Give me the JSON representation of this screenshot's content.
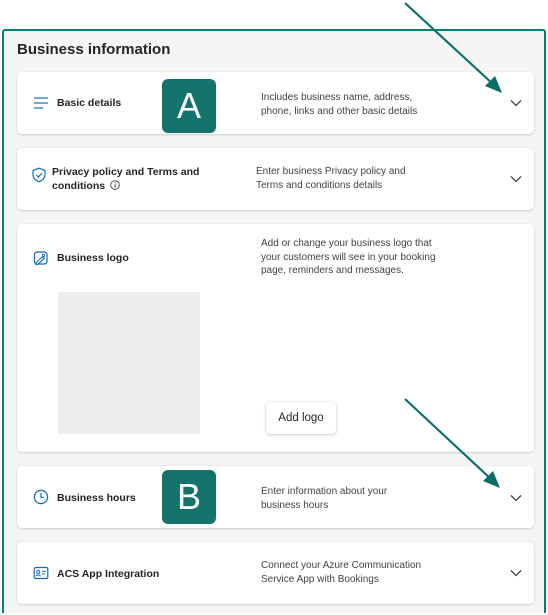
{
  "page": {
    "title": "Business information"
  },
  "sections": {
    "basic": {
      "title": "Basic details",
      "description": "Includes business name, address, phone, links and other basic details"
    },
    "privacy": {
      "title_line1": "Privacy policy and Terms and",
      "title_line2": "conditions",
      "description": "Enter business Privacy policy and Terms and conditions details"
    },
    "logo": {
      "title": "Business logo",
      "description": "Add or change your business logo that your customers will see in your booking page, reminders and messages.",
      "button_label": "Add logo"
    },
    "hours": {
      "title": "Business hours",
      "description": "Enter information about your business hours"
    },
    "acs": {
      "title": "ACS App Integration",
      "description": "Connect your Azure Communication Service App with Bookings"
    }
  },
  "annotations": {
    "badge_a": "A",
    "badge_b": "B"
  },
  "colors": {
    "accent_teal": "#00827a",
    "badge_bg": "#14736c",
    "icon_blue": "#0f6cbd"
  }
}
